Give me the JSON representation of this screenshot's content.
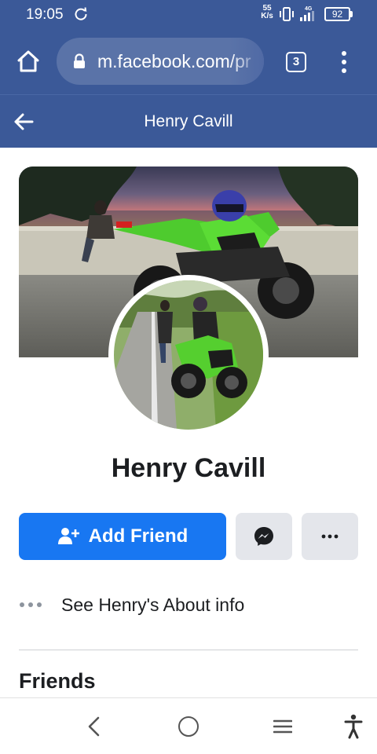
{
  "status_bar": {
    "time": "19:05",
    "net_speed_top": "55",
    "net_speed_bottom": "K/s",
    "network_type": "4G",
    "battery": "92"
  },
  "browser": {
    "url": "m.facebook.com/pr",
    "tab_count": "3"
  },
  "page_header": {
    "title": "Henry Cavill"
  },
  "profile": {
    "name": "Henry Cavill",
    "add_friend_label": "Add Friend",
    "about_label": "See Henry's About info",
    "friends_title": "Friends"
  },
  "colors": {
    "brand_blue": "#3b5998",
    "button_blue": "#1877f2",
    "secondary_button": "#e4e6eb"
  },
  "icons": {
    "home": "home-icon",
    "lock": "lock-icon",
    "tabs": "tab-switcher-icon",
    "menu": "kebab-menu-icon",
    "back": "back-arrow-icon",
    "add_friend": "add-person-icon",
    "messenger": "messenger-icon",
    "more": "more-dots-icon"
  }
}
